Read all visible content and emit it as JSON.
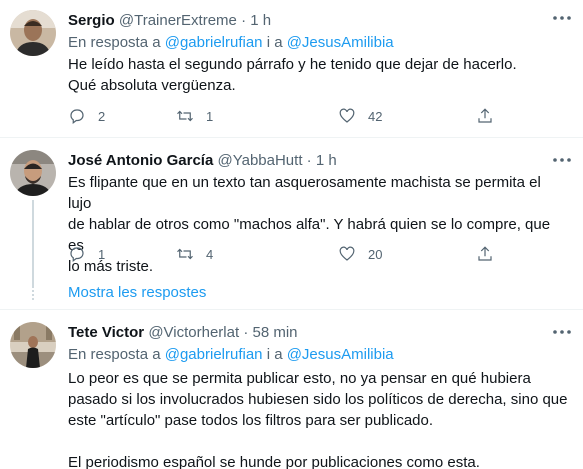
{
  "tweets": [
    {
      "name": "Sergio",
      "handle": "@TrainerExtreme",
      "dot": "·",
      "time": "1 h",
      "reply_prefix": "En resposta a",
      "reply_mention_1": "@gabrielrufian",
      "reply_joiner": "i a",
      "reply_mention_2": "@JesusAmilibia",
      "lines": [
        "He leído hasta el segundo párrafo y he tenido que dejar de hacerlo.",
        "Qué absoluta vergüenza."
      ],
      "replies": "2",
      "retweets": "1",
      "likes": "42"
    },
    {
      "name": "José Antonio García",
      "handle": "@YabbaHutt",
      "dot": "·",
      "time": "1 h",
      "lines": [
        "Es flipante que en un texto tan asquerosamente machista se permita el lujo",
        "de hablar de otros como \"machos alfa\". Y habrá quien se lo compre, que es",
        "lo más triste."
      ],
      "replies": "1",
      "retweets": "4",
      "likes": "20"
    },
    {
      "name": "Tete Victor",
      "handle": "@Victorherlat",
      "dot": "·",
      "time": "58 min",
      "reply_prefix": "En resposta a",
      "reply_mention_1": "@gabrielrufian",
      "reply_joiner": "i a",
      "reply_mention_2": "@JesusAmilibia",
      "paragraph_1": [
        "Lo peor es que se permita publicar esto, no ya pensar en qué hubiera",
        "pasado si los involucrados  hubiesen sido los políticos de derecha, sino que",
        "este \"artículo\" pase todos los filtros para ser publicado."
      ],
      "paragraph_2": "El periodismo español se hunde por publicaciones como esta."
    }
  ],
  "show_replies_label": "Mostra les respostes",
  "icons": {
    "more": "more-horizontal-icon",
    "reply": "reply-icon",
    "retweet": "retweet-icon",
    "like": "heart-icon",
    "share": "share-icon"
  },
  "colors": {
    "link": "#1d9bf0",
    "secondary_text": "#536471",
    "divider": "#eff3f4"
  }
}
